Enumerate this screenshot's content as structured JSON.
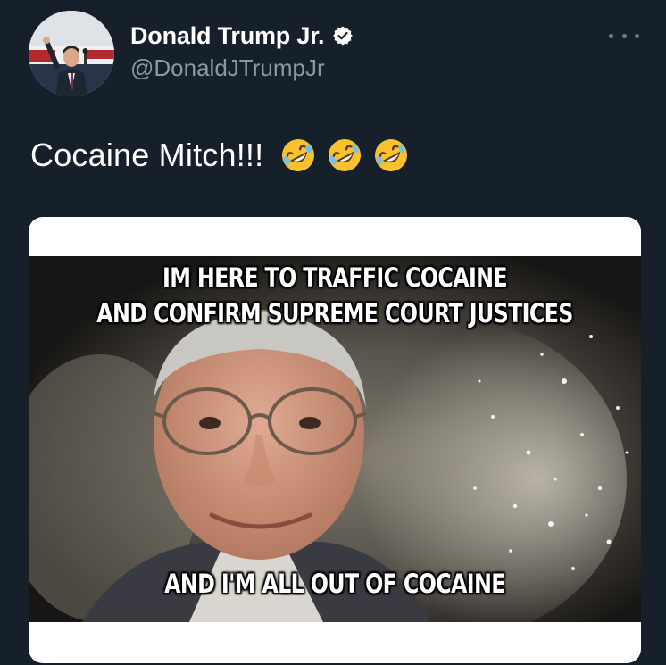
{
  "tweet": {
    "author": {
      "display_name": "Donald Trump Jr.",
      "handle": "@DonaldJTrumpJr",
      "verified": true
    },
    "text": "Cocaine Mitch!!!",
    "emojis": [
      "rolling-on-the-floor-laughing",
      "rolling-on-the-floor-laughing",
      "rolling-on-the-floor-laughing"
    ],
    "media": {
      "caption_top_line1": "IM HERE TO TRAFFIC COCAINE",
      "caption_top_line2": "AND CONFIRM SUPREME COURT JUSTICES",
      "caption_bottom": "AND I'M ALL OUT OF COCAINE"
    }
  },
  "colors": {
    "background": "#15202b",
    "name_text": "#ffffff",
    "handle_text": "#8899a6",
    "verified_badge": "#ffffff",
    "card": "#ffffff"
  },
  "icons": {
    "verified": "verified-badge-icon",
    "more": "more-dots-icon"
  }
}
